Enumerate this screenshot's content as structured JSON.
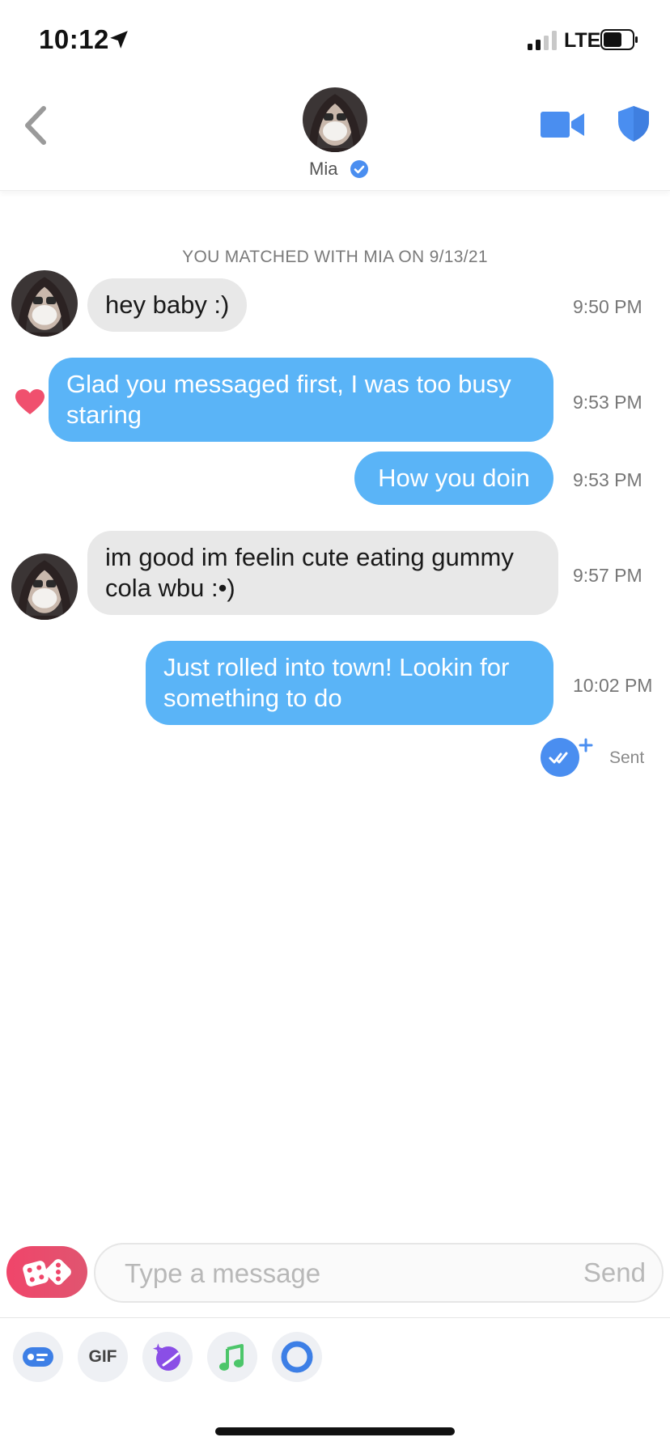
{
  "status_bar": {
    "time": "10:12",
    "network": "LTE"
  },
  "header": {
    "contact_name": "Mia"
  },
  "chat": {
    "match_banner": "YOU MATCHED WITH MIA ON 9/13/21",
    "messages": [
      {
        "from": "them",
        "text": "hey baby :)",
        "time": "9:50 PM"
      },
      {
        "from": "me",
        "text": "Glad you messaged first, I was too busy staring",
        "time": "9:53 PM",
        "liked": true
      },
      {
        "from": "me",
        "text": "How you doin",
        "time": "9:53 PM"
      },
      {
        "from": "them",
        "text": "im good im feelin cute eating gummy cola wbu :•)",
        "time": "9:57 PM"
      },
      {
        "from": "me",
        "text": "Just rolled into town! Lookin for something to do",
        "time": "10:02 PM"
      }
    ],
    "read_status": "Sent"
  },
  "composer": {
    "placeholder": "Type a message",
    "send_label": "Send",
    "tools": [
      {
        "name": "card-icon"
      },
      {
        "name": "gif-icon",
        "label": "GIF"
      },
      {
        "name": "sticker-icon"
      },
      {
        "name": "music-icon"
      },
      {
        "name": "circle-icon"
      }
    ]
  },
  "colors": {
    "brand_blue": "#4a8ef0",
    "outgoing_bubble": "#5ab4f7",
    "incoming_bubble": "#e8e8e8",
    "heart": "#f0506e",
    "dice_button": "#f0456a"
  }
}
